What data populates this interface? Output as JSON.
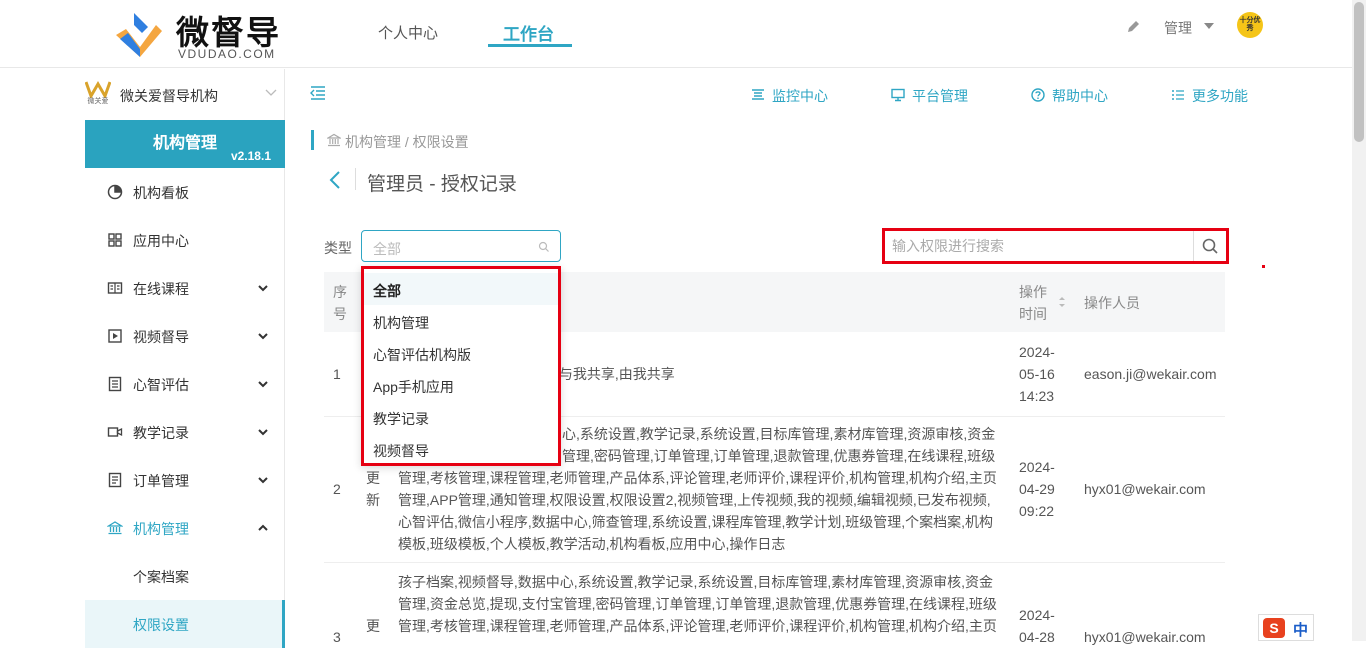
{
  "header": {
    "logo_text": "微督导",
    "logo_sub": "VDUDAO.COM",
    "nav": [
      {
        "label": "个人中心"
      },
      {
        "label": "工作台"
      }
    ],
    "user_menu_label": "管理",
    "avatar_text": "十分优秀"
  },
  "sidebar": {
    "org_logo_text": "微关爱",
    "org_name": "微关爱督导机构",
    "module_title": "机构管理",
    "module_version": "v2.18.1",
    "items": [
      {
        "label": "机构看板",
        "icon": "pie-chart-icon"
      },
      {
        "label": "应用中心",
        "icon": "grid-icon"
      },
      {
        "label": "在线课程",
        "icon": "book-icon"
      },
      {
        "label": "视频督导",
        "icon": "play-icon"
      },
      {
        "label": "心智评估",
        "icon": "list-icon"
      },
      {
        "label": "教学记录",
        "icon": "video-icon"
      },
      {
        "label": "订单管理",
        "icon": "receipt-icon"
      },
      {
        "label": "机构管理",
        "icon": "bank-icon"
      }
    ],
    "subitems": [
      {
        "label": "个案档案"
      },
      {
        "label": "权限设置"
      }
    ]
  },
  "toolbar": {
    "items": [
      {
        "label": "监控中心"
      },
      {
        "label": "平台管理"
      },
      {
        "label": "帮助中心"
      },
      {
        "label": "更多功能"
      }
    ]
  },
  "content": {
    "breadcrumb": "机构管理 / 权限设置",
    "page_title": "管理员 - 授权记录",
    "filter_label": "类型",
    "type_select_value": "全部",
    "search_placeholder": "输入权限进行搜索"
  },
  "table": {
    "headers": {
      "index_1": "序",
      "index_2": "号",
      "time_1": "操作",
      "time_2": "时间",
      "operator": "操作人员"
    },
    "rows": [
      {
        "index": "1",
        "type": "",
        "desc": "级,与我共享,由我共享",
        "date": "2024-",
        "date2": "05-16",
        "time": "14:23",
        "operator": "eason.ji@wekair.com"
      },
      {
        "index": "2",
        "type_1": "更",
        "type_2": "新",
        "desc_lines": [
          "心,系统设置,教学记录,系统设置,目标库管理,素材库管理,资源审核,资金",
          "管理,密码管理,订单管理,订单管理,退款管理,优惠券管理,在线课程,班级",
          "管理,考核管理,课程管理,老师管理,产品体系,评论管理,老师评价,课程评价,机构管理,机构介绍,主页",
          "管理,APP管理,通知管理,权限设置,权限设置2,视频管理,上传视频,我的视频,编辑视频,已发布视频,",
          "心智评估,微信小程序,数据中心,筛查管理,系统设置,课程库管理,教学计划,班级管理,个案档案,机构",
          "模板,班级模板,个人模板,教学活动,机构看板,应用中心,操作日志"
        ],
        "date": "2024-",
        "date2": "04-29",
        "time": "09:22",
        "operator": "hyx01@wekair.com"
      },
      {
        "index": "3",
        "type_1": "更",
        "desc_lines": [
          "孩子档案,视频督导,数据中心,系统设置,教学记录,系统设置,目标库管理,素材库管理,资源审核,资金",
          "管理,资金总览,提现,支付宝管理,密码管理,订单管理,订单管理,退款管理,优惠券管理,在线课程,班级",
          "管理,考核管理,课程管理,老师管理,产品体系,评论管理,老师评价,课程评价,机构管理,机构介绍,主页"
        ],
        "date": "2024-",
        "date2": "04-28",
        "operator": "hyx01@wekair.com"
      }
    ]
  },
  "dropdown": {
    "options": [
      {
        "label": "全部"
      },
      {
        "label": "机构管理"
      },
      {
        "label": "心智评估机构版"
      },
      {
        "label": "App手机应用"
      },
      {
        "label": "教学记录"
      },
      {
        "label": "视频督导"
      }
    ]
  },
  "ime": {
    "label": "中"
  },
  "colors": {
    "accent": "#2fa6c4",
    "highlight": "#e60012",
    "module_bg": "#2aa3bf"
  }
}
